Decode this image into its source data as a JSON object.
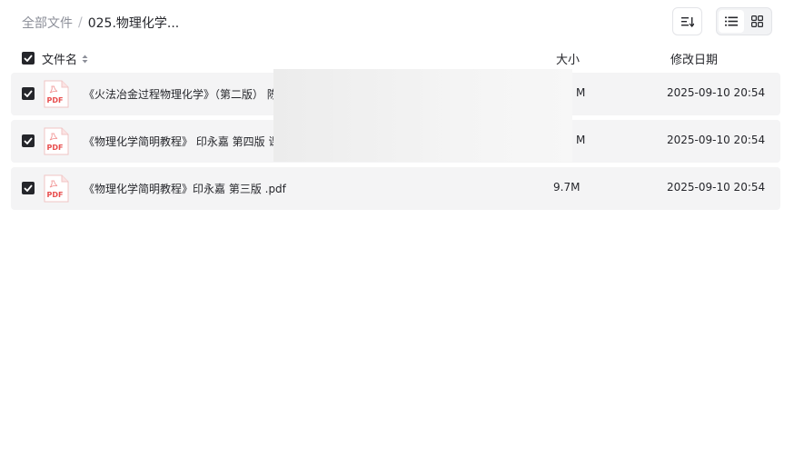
{
  "breadcrumb": {
    "root": "全部文件",
    "separator": "/",
    "current": "025.物理化学..."
  },
  "toolbar": {
    "sort_icon": "sort-icon",
    "list_view_icon": "list-view-icon",
    "grid_view_icon": "grid-view-icon",
    "active_view": "list"
  },
  "table": {
    "headers": {
      "name": "文件名",
      "size": "大小",
      "modified": "修改日期"
    },
    "rows": [
      {
        "icon": "pdf-file-icon",
        "icon_label": "PDF",
        "name": "《火法冶金过程物理化学》（第二版） 陈",
        "size": "M",
        "date": "2025-09-10 20:54",
        "checked": true
      },
      {
        "icon": "pdf-file-icon",
        "icon_label": "PDF",
        "name": "《物理化学简明教程》 印永嘉 第四版 课",
        "size": "M",
        "date": "2025-09-10 20:54",
        "checked": true
      },
      {
        "icon": "pdf-file-icon",
        "icon_label": "PDF",
        "name": "《物理化学简明教程》印永嘉 第三版 .pdf",
        "size": "9.7M",
        "date": "2025-09-10 20:54",
        "checked": true
      }
    ]
  },
  "colors": {
    "checkbox": "#25262b",
    "row_bg": "#f4f4f5",
    "pdf_red": "#e84e4e"
  }
}
